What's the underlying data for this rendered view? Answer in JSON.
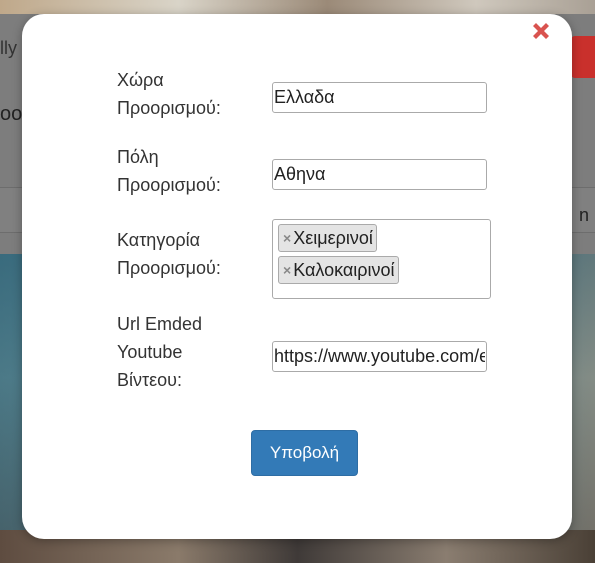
{
  "background": {
    "left_text": "lly",
    "left_text2": "oo",
    "right_text": "n"
  },
  "modal": {
    "close_label": "✖",
    "fields": {
      "country": {
        "label_line1": "Χώρα",
        "label_line2": "Προορισμού:",
        "value": "Ελλαδα"
      },
      "city": {
        "label_line1": "Πόλη",
        "label_line2": "Προορισμού:",
        "value": "Αθηνα"
      },
      "category": {
        "label_line1": "Κατηγορία",
        "label_line2": "Προορισμού:",
        "tags": [
          {
            "remove": "×",
            "label": "Χειμερινοί"
          },
          {
            "remove": "×",
            "label": "Καλοκαιρινοί"
          }
        ]
      },
      "youtube": {
        "label_line1": "Url Emded",
        "label_line2": "Youtube",
        "label_line3": "Βίντεου:",
        "value": "https://www.youtube.com/embed"
      }
    },
    "submit_label": "Υποβολή"
  },
  "colors": {
    "close": "#d9534f",
    "primary": "#337ab7"
  }
}
